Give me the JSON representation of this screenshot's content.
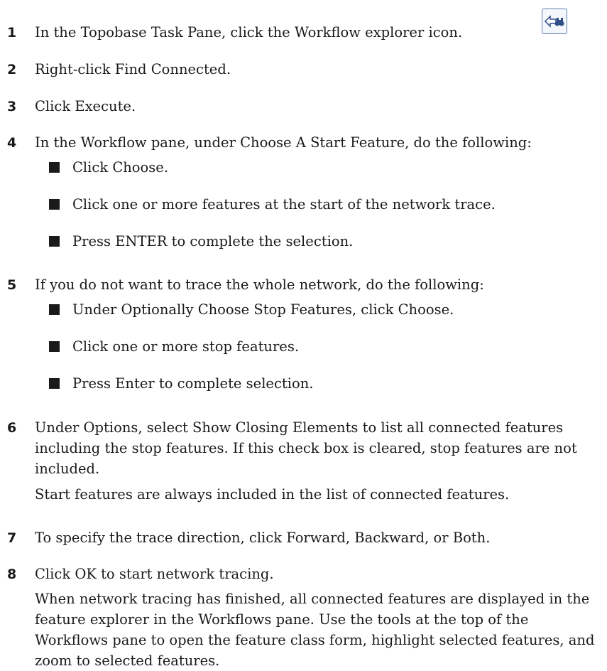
{
  "steps": [
    {
      "num": "1",
      "text": "In the Topobase Task Pane, click the Workflow explorer icon.",
      "icon": "workflow-explorer-icon"
    },
    {
      "num": "2",
      "text": "Right-click Find Connected."
    },
    {
      "num": "3",
      "text": "Click Execute."
    },
    {
      "num": "4",
      "text": "In the Workflow pane, under Choose A Start Feature, do the following:",
      "bullets": [
        "Click Choose.",
        "Click one or more features at the start of the network trace.",
        "Press ENTER to complete the selection."
      ]
    },
    {
      "num": "5",
      "text": "If you do not want to trace the whole network, do the following:",
      "bullets": [
        "Under Optionally Choose Stop Features, click Choose.",
        "Click one or more stop features.",
        "Press Enter to complete selection."
      ]
    },
    {
      "num": "6",
      "text": "Under Options, select Show Closing Elements to list all connected features including the stop features. If this check box is cleared, stop features are not included.",
      "note": "Start features are always included in the list of connected features."
    },
    {
      "num": "7",
      "text": "To specify the trace direction, click Forward, Backward, or Both."
    },
    {
      "num": "8",
      "text": "Click OK to start network tracing.",
      "note": "When network tracing has finished, all connected features are displayed in the feature explorer in the Workflows pane. Use the tools at the top of the Workflows pane to open the feature class form, highlight selected features, and zoom to selected features."
    }
  ]
}
